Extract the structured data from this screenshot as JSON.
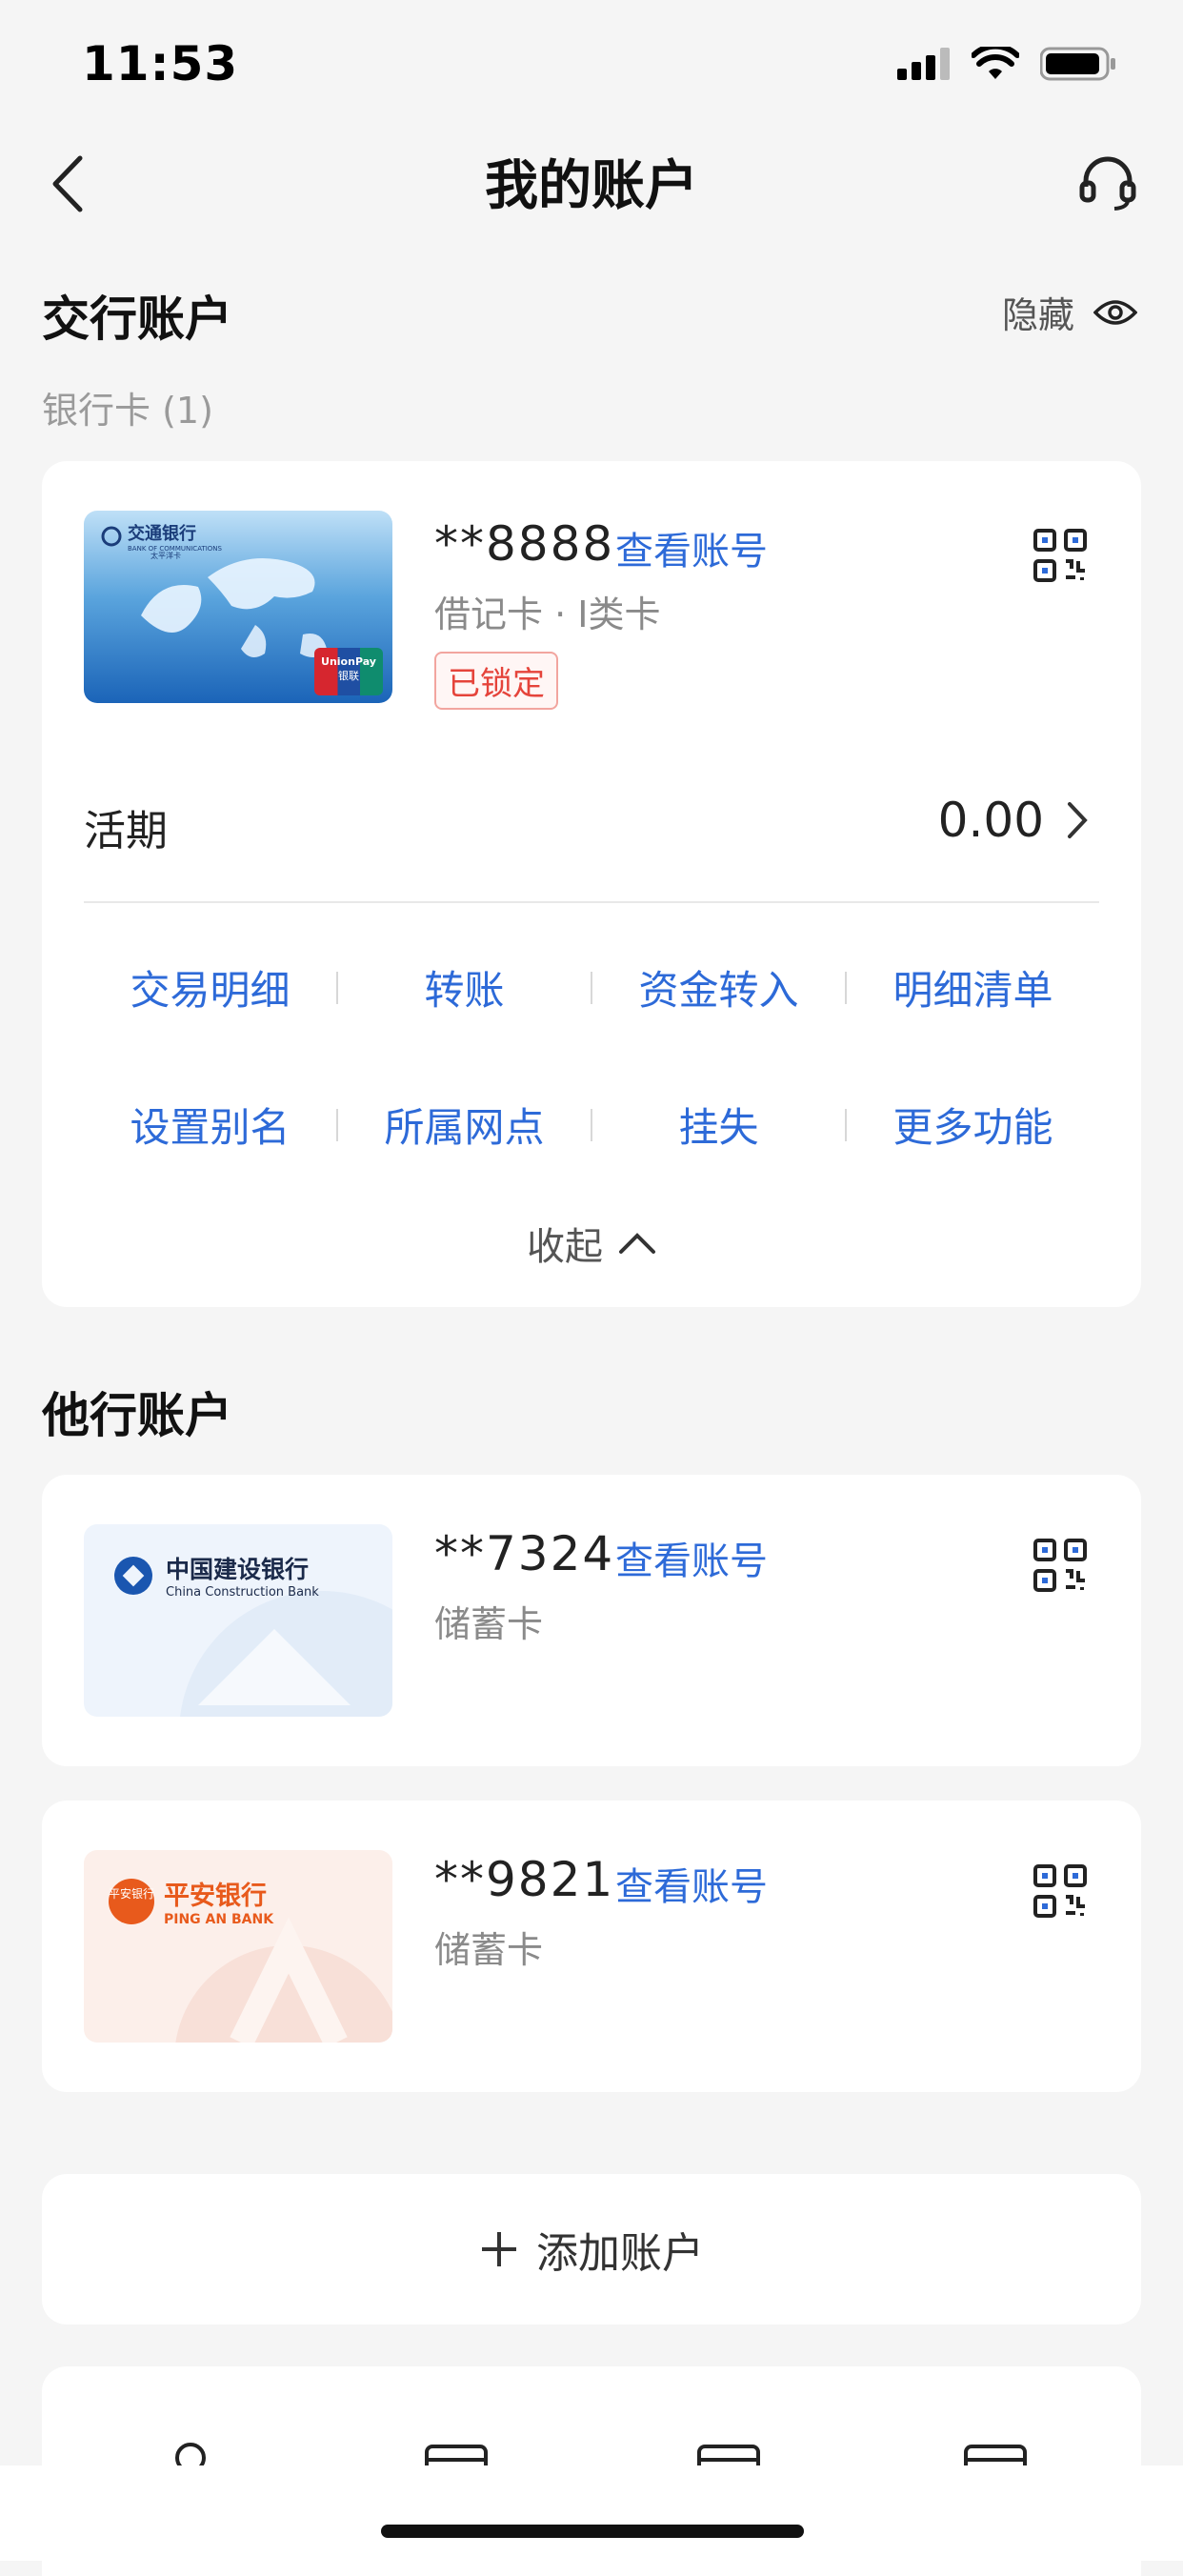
{
  "status": {
    "time": "11:53"
  },
  "nav": {
    "title": "我的账户"
  },
  "own_section": {
    "title": "交行账户",
    "hide_label": "隐藏",
    "card_count_label": "银行卡 (1)",
    "card": {
      "bank_name_cn": "交通银行",
      "bank_name_en": "BANK OF COMMUNICATIONS",
      "bank_sub": "太平洋卡",
      "unionpay": "UnionPay",
      "unionpay_cn": "银联",
      "account_no": "**8888",
      "view_label": "查看账号",
      "type": "借记卡 · I类卡",
      "status": "已锁定",
      "balance_label": "活期",
      "balance": "0.00",
      "actions_row1": [
        "交易明细",
        "转账",
        "资金转入",
        "明细清单"
      ],
      "actions_row2": [
        "设置别名",
        "所属网点",
        "挂失",
        "更多功能"
      ],
      "collapse_label": "收起"
    }
  },
  "other_section": {
    "title": "他行账户",
    "cards": [
      {
        "bank_cn": "中国建设银行",
        "bank_en": "China Construction Bank",
        "account_no": "**7324",
        "view_label": "查看账号",
        "type": "储蓄卡"
      },
      {
        "bank_cn": "平安银行",
        "bank_en": "PING AN BANK",
        "logo_text": "平安银行",
        "account_no": "**9821",
        "view_label": "查看账号",
        "type": "储蓄卡"
      }
    ]
  },
  "add_account_label": "添加账户",
  "colors": {
    "accent": "#2d6ad8",
    "danger": "#e5443b"
  }
}
